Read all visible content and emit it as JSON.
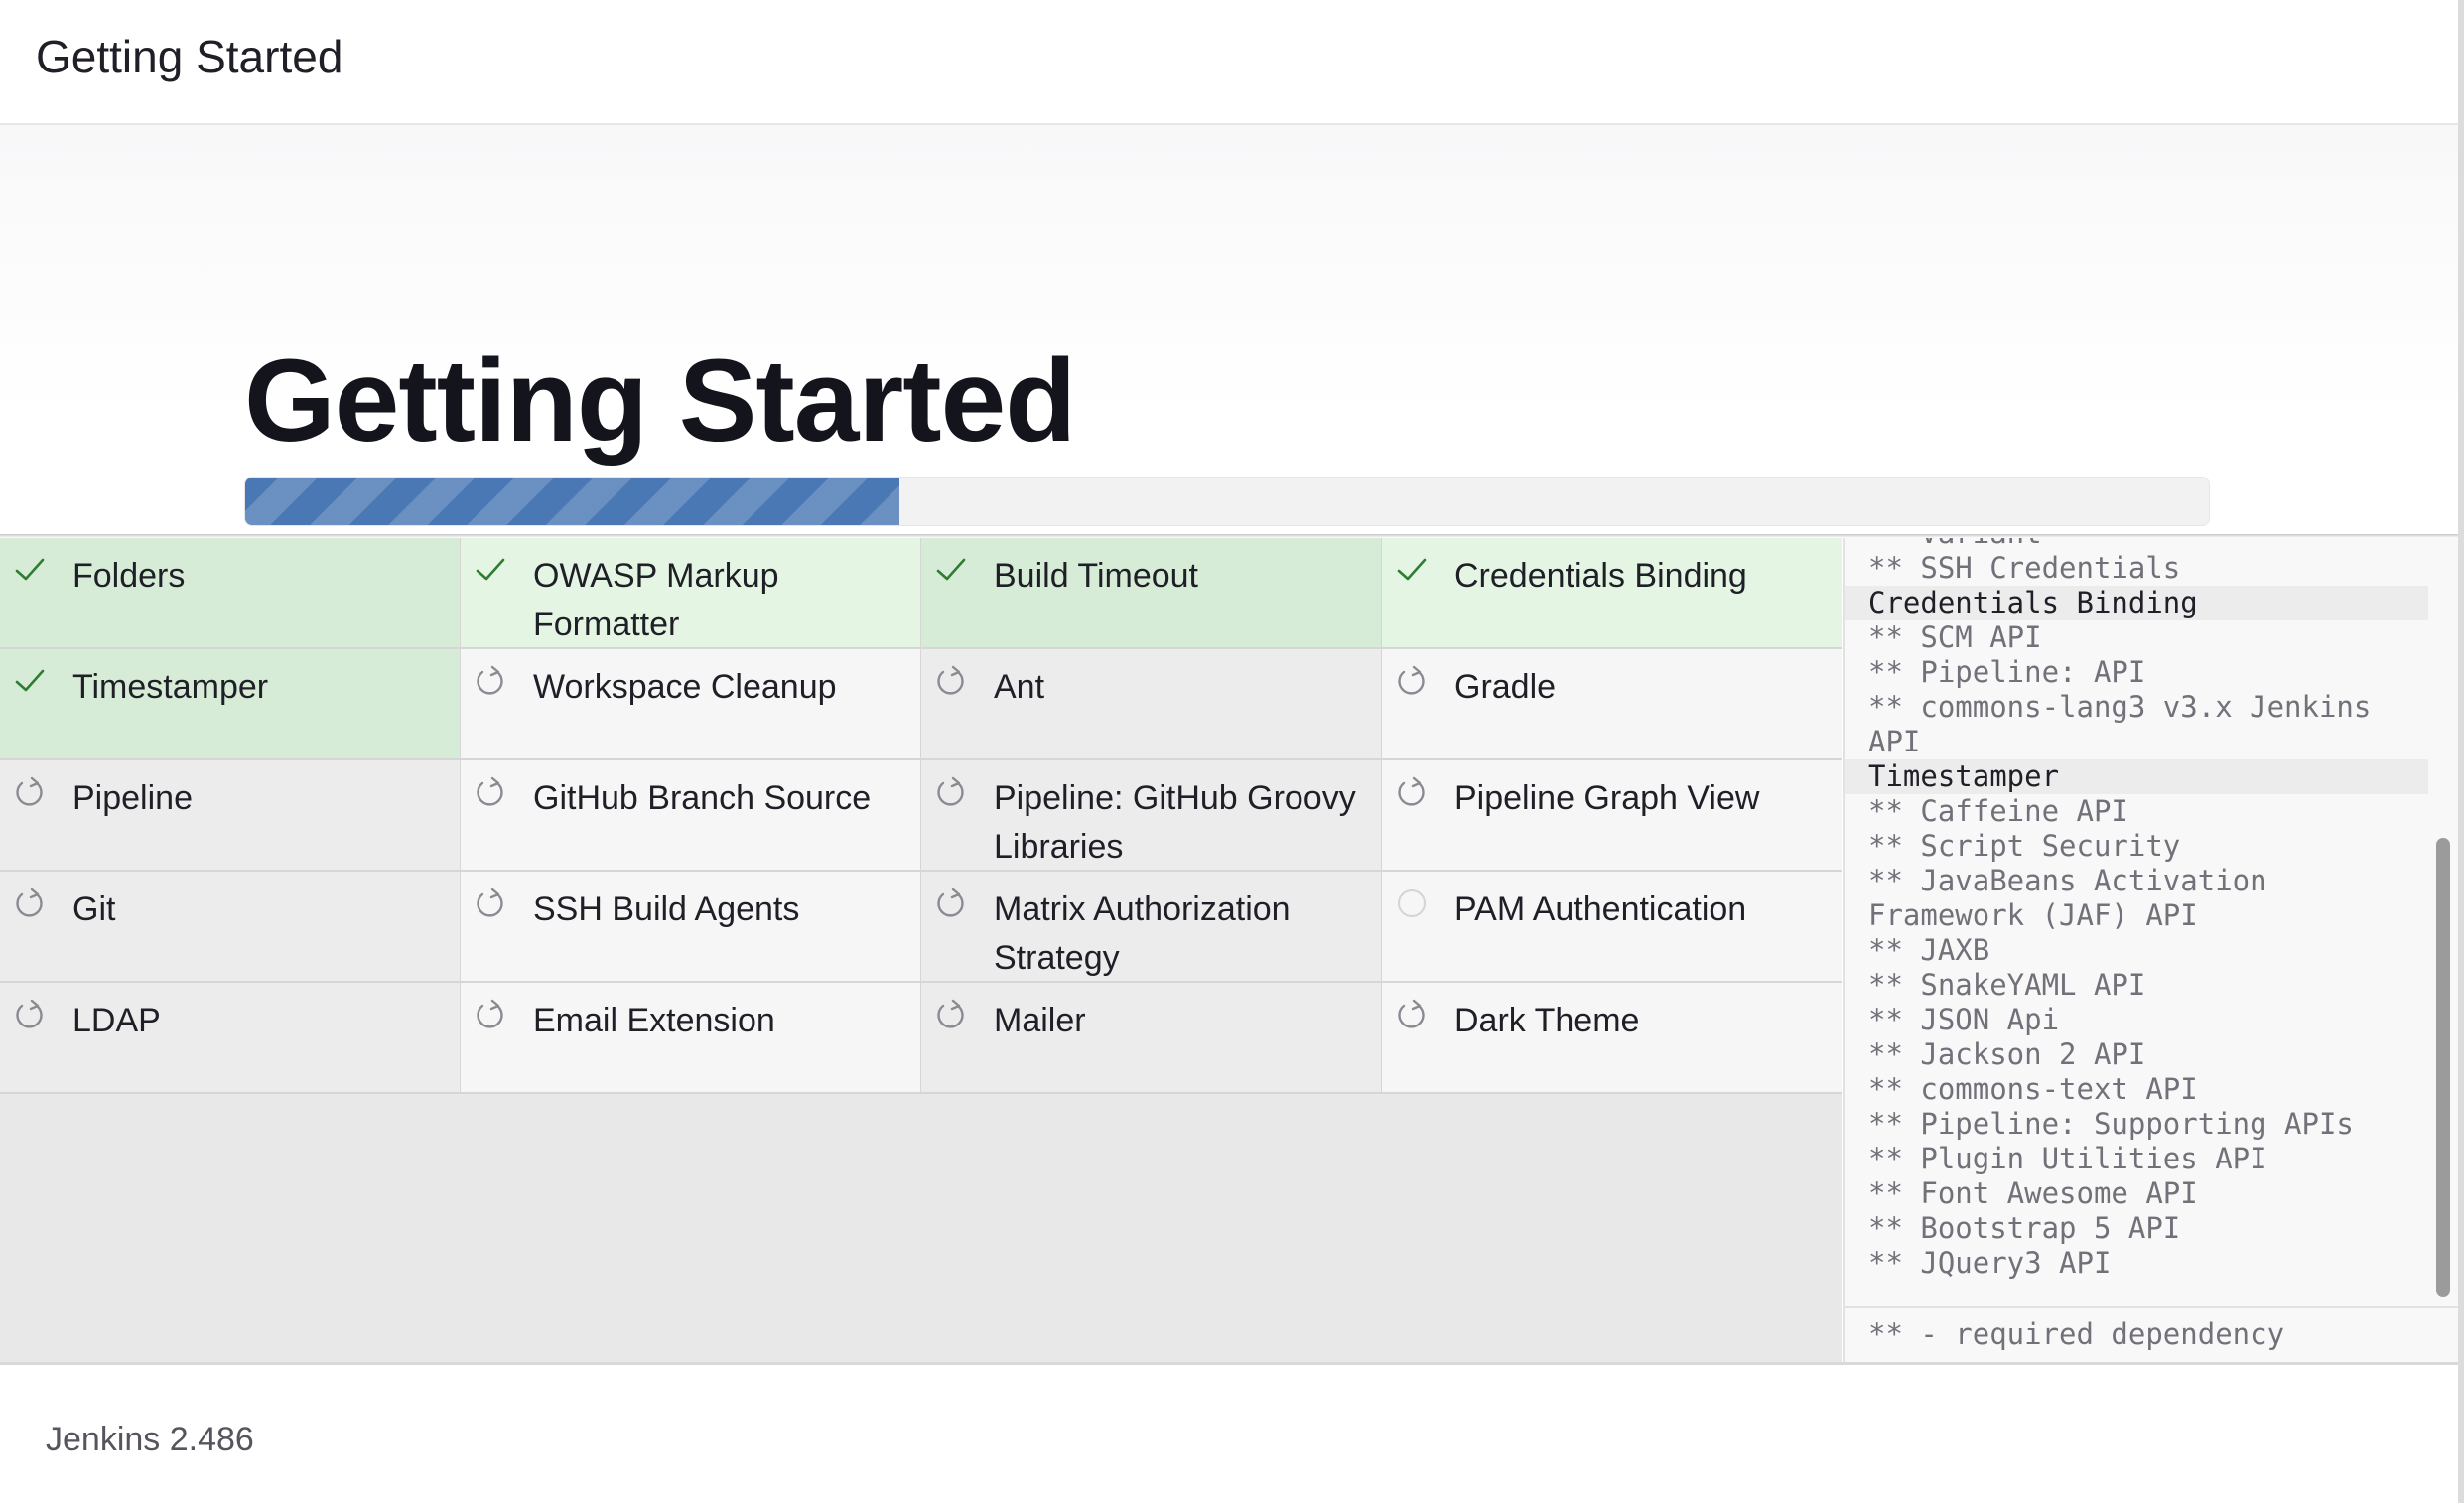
{
  "header": {
    "title": "Getting Started"
  },
  "hero": {
    "title": "Getting Started",
    "progress": 0.333
  },
  "plugins": [
    {
      "label": "Folders",
      "status": "installed",
      "icon": "check-icon"
    },
    {
      "label": "OWASP Markup Formatter",
      "status": "installed",
      "icon": "check-icon"
    },
    {
      "label": "Build Timeout",
      "status": "installed",
      "icon": "check-icon"
    },
    {
      "label": "Credentials Binding",
      "status": "installed",
      "icon": "check-icon"
    },
    {
      "label": "Timestamper",
      "status": "installed",
      "icon": "check-icon"
    },
    {
      "label": "Workspace Cleanup",
      "status": "pending",
      "icon": "refresh-icon"
    },
    {
      "label": "Ant",
      "status": "pending",
      "icon": "refresh-icon"
    },
    {
      "label": "Gradle",
      "status": "pending",
      "icon": "refresh-icon"
    },
    {
      "label": "Pipeline",
      "status": "pending",
      "icon": "refresh-icon"
    },
    {
      "label": "GitHub Branch Source",
      "status": "pending",
      "icon": "refresh-icon"
    },
    {
      "label": "Pipeline: GitHub Groovy Libraries",
      "status": "pending",
      "icon": "refresh-icon"
    },
    {
      "label": "Pipeline Graph View",
      "status": "pending",
      "icon": "refresh-icon"
    },
    {
      "label": "Git",
      "status": "pending",
      "icon": "refresh-icon"
    },
    {
      "label": "SSH Build Agents",
      "status": "pending",
      "icon": "refresh-icon"
    },
    {
      "label": "Matrix Authorization Strategy",
      "status": "pending",
      "icon": "refresh-icon"
    },
    {
      "label": "PAM Authentication",
      "status": "waiting",
      "icon": "circle-icon"
    },
    {
      "label": "LDAP",
      "status": "pending",
      "icon": "refresh-icon"
    },
    {
      "label": "Email Extension",
      "status": "pending",
      "icon": "refresh-icon"
    },
    {
      "label": "Mailer",
      "status": "pending",
      "icon": "refresh-icon"
    },
    {
      "label": "Dark Theme",
      "status": "pending",
      "icon": "refresh-icon"
    }
  ],
  "log": {
    "lines": [
      {
        "text": "** Variant",
        "head": false
      },
      {
        "text": "** SSH Credentials",
        "head": false
      },
      {
        "text": "Credentials Binding",
        "head": true
      },
      {
        "text": "** SCM API",
        "head": false
      },
      {
        "text": "** Pipeline: API",
        "head": false
      },
      {
        "text": "** commons-lang3 v3.x Jenkins API",
        "head": false
      },
      {
        "text": "Timestamper",
        "head": true
      },
      {
        "text": "** Caffeine API",
        "head": false
      },
      {
        "text": "** Script Security",
        "head": false
      },
      {
        "text": "** JavaBeans Activation Framework (JAF) API",
        "head": false
      },
      {
        "text": "** JAXB",
        "head": false
      },
      {
        "text": "** SnakeYAML API",
        "head": false
      },
      {
        "text": "** JSON Api",
        "head": false
      },
      {
        "text": "** Jackson 2 API",
        "head": false
      },
      {
        "text": "** commons-text API",
        "head": false
      },
      {
        "text": "** Pipeline: Supporting APIs",
        "head": false
      },
      {
        "text": "** Plugin Utilities API",
        "head": false
      },
      {
        "text": "** Font Awesome API",
        "head": false
      },
      {
        "text": "** Bootstrap 5 API",
        "head": false
      },
      {
        "text": "** JQuery3 API",
        "head": false
      }
    ],
    "footer": "** - required dependency"
  },
  "footer": {
    "version": "Jenkins 2.486"
  },
  "colors": {
    "accent": "#4a78b4",
    "installed_bg": "#e5f5e4",
    "installed_bg_alt": "#d7ecd6",
    "check": "#2e7d32",
    "pending_icon": "#8a8a92"
  }
}
